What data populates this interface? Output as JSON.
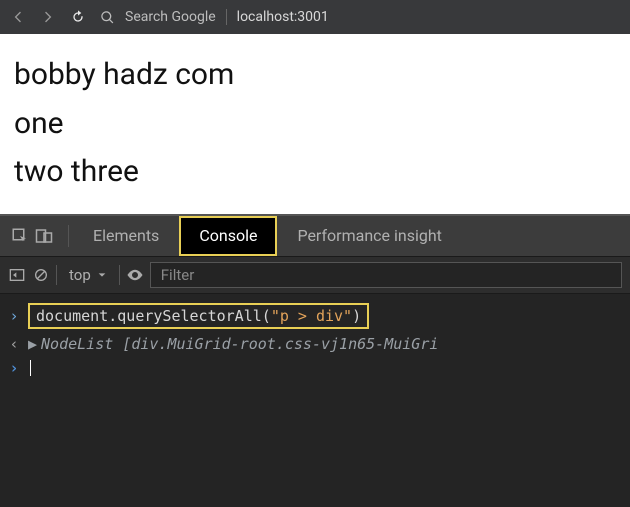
{
  "toolbar": {
    "search_placeholder": "Search Google",
    "url": "localhost:3001"
  },
  "page": {
    "lines": [
      "bobby hadz com",
      "one",
      "two three"
    ]
  },
  "devtools": {
    "tabs": {
      "elements": "Elements",
      "console": "Console",
      "perf": "Performance insight"
    },
    "filterbar": {
      "context": "top",
      "filter_placeholder": "Filter"
    },
    "console": {
      "input_obj": "document",
      "input_method": "querySelectorAll",
      "input_arg": "\"p > div\"",
      "output_prefix": "NodeList ",
      "output_body": "[div.MuiGrid-root.css-vj1n65-MuiGri"
    }
  }
}
